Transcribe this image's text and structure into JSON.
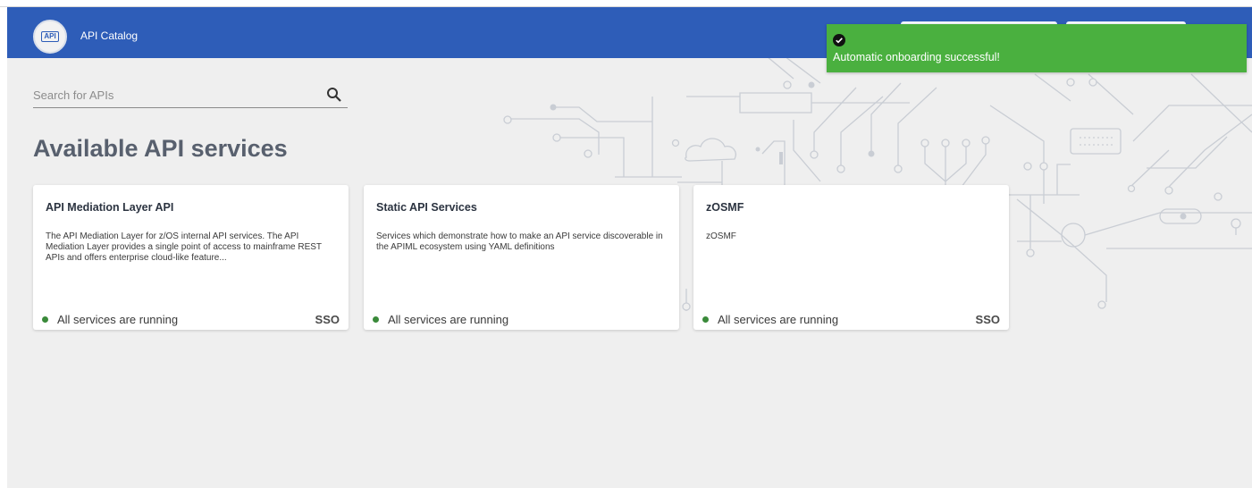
{
  "header": {
    "title": "API Catalog",
    "logo_text": "API",
    "color": "#2e5db8"
  },
  "toast": {
    "message": "Automatic onboarding successful!",
    "color": "#4ab03f",
    "icon": "check-circle-icon"
  },
  "search": {
    "placeholder": "Search for APIs",
    "value": "",
    "icon": "search-icon"
  },
  "page_title": "Available API services",
  "cards": [
    {
      "title": "API Mediation Layer API",
      "description": "The API Mediation Layer for z/OS internal API services. The API Mediation Layer provides a single point of access to mainframe REST APIs and offers enterprise cloud-like feature...",
      "status": "All services are running",
      "badge": "SSO"
    },
    {
      "title": "Static API Services",
      "description": "Services which demonstrate how to make an API service discoverable in the APIML ecosystem using YAML definitions",
      "status": "All services are running",
      "badge": ""
    },
    {
      "title": "zOSMF",
      "description": "zOSMF",
      "status": "All services are running",
      "badge": "SSO"
    }
  ],
  "status_color": "#3a8a3a"
}
